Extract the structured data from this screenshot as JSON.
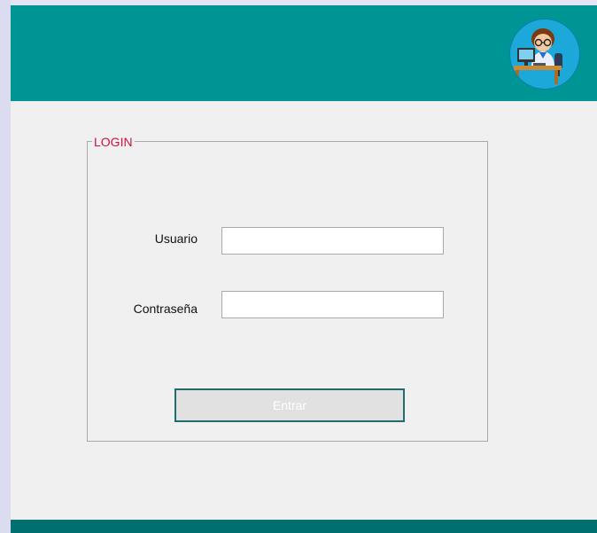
{
  "header": {
    "avatar_icon": "programmer-at-desk-icon",
    "color": "#009595"
  },
  "login": {
    "title": "LOGIN",
    "title_color": "#d0103a",
    "username_label": "Usuario",
    "username_value": "",
    "password_label": "Contraseña",
    "password_value": "",
    "submit_label": "Entrar"
  },
  "footer": {
    "color": "#006f6f"
  }
}
